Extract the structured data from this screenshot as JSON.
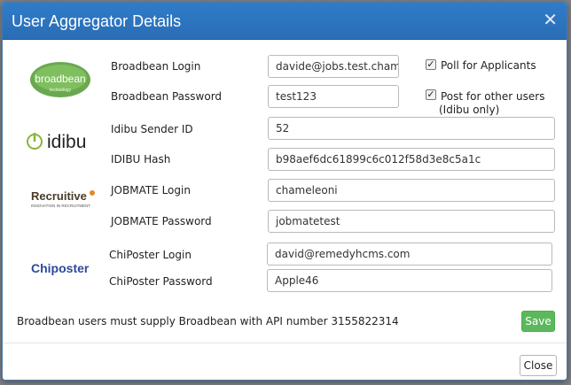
{
  "modal": {
    "title": "User Aggregator Details",
    "close_icon": "close-icon",
    "accent_color": "#2f7cc9"
  },
  "logos": {
    "broadbean": {
      "text": "broadbean",
      "sub": "technology"
    },
    "idibu": {
      "text": "idibu"
    },
    "recruitive": {
      "text": "Recruitive",
      "sub": "INNOVATION IN RECRUITMENT"
    },
    "chiposter": {
      "text": "Chiposter"
    }
  },
  "form": {
    "broadbean_login": {
      "label": "Broadbean Login",
      "value": "davide@jobs.test.cham"
    },
    "broadbean_password": {
      "label": "Broadbean Password",
      "value": "test123"
    },
    "idibu_sender_id": {
      "label": "Idibu Sender ID",
      "value": "52"
    },
    "idibu_hash": {
      "label": "IDIBU Hash",
      "value": "b98aef6dc61899c6c012f58d3e8c5a1c"
    },
    "jobmate_login": {
      "label": "JOBMATE Login",
      "value": "chameleoni"
    },
    "jobmate_password": {
      "label": "JOBMATE Password",
      "value": "jobmatetest"
    },
    "chiposter_login": {
      "label": "ChiPoster Login",
      "value": "david@remedyhcms.com"
    },
    "chiposter_password": {
      "label": "ChiPoster Password",
      "value": "Apple46"
    }
  },
  "options": {
    "poll_for_applicants": {
      "label": "Poll for Applicants",
      "checked": true
    },
    "post_for_other_users": {
      "label_line1": "Post for other users",
      "label_line2": "(Idibu only)",
      "checked": true
    }
  },
  "footer": {
    "note": "Broadbean users must supply Broadbean with API number 3155822314",
    "save_label": "Save",
    "close_label": "Close",
    "save_color": "#5cb85c"
  }
}
